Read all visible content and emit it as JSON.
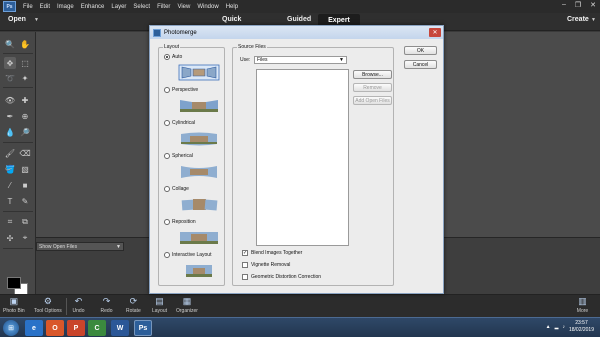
{
  "menubar": {
    "logo": "Ps",
    "items": [
      "File",
      "Edit",
      "Image",
      "Enhance",
      "Layer",
      "Select",
      "Filter",
      "View",
      "Window",
      "Help"
    ]
  },
  "modebar": {
    "open_label": "Open",
    "modes": [
      "Quick",
      "Guided",
      "Expert"
    ],
    "active_mode": "Expert",
    "create_label": "Create"
  },
  "options": {
    "show_files_label": "Show Open Files"
  },
  "dialog": {
    "title": "Photomerge",
    "layout_group_label": "Layout",
    "layout_options": [
      "Auto",
      "Perspective",
      "Cylindrical",
      "Spherical",
      "Collage",
      "Reposition",
      "Interactive Layout"
    ],
    "selected_layout": "Auto",
    "source_group_label": "Source Files",
    "use_label": "Use:",
    "use_value": "Files",
    "buttons": {
      "ok": "OK",
      "cancel": "Cancel",
      "browse": "Browse...",
      "remove": "Remove",
      "add_open_files": "Add Open Files"
    },
    "checkboxes": [
      {
        "label": "Blend Images Together",
        "checked": true
      },
      {
        "label": "Vignette Removal",
        "checked": false
      },
      {
        "label": "Geometric Distortion Correction",
        "checked": false
      }
    ]
  },
  "bottombar": {
    "left_items": [
      "Photo Bin",
      "Tool Options",
      "Undo",
      "Redo",
      "Rotate",
      "Layout",
      "Organizer"
    ],
    "more_label": "More"
  },
  "taskbar": {
    "apps": [
      "e",
      "O",
      "P",
      "C",
      "W",
      "Ps"
    ],
    "time": "23:57",
    "date": "18/02/2019"
  },
  "colors": {
    "accent": "#2d5f9a",
    "dialog_bg": "#ececec",
    "workspace_bg": "#4b4b4b"
  }
}
